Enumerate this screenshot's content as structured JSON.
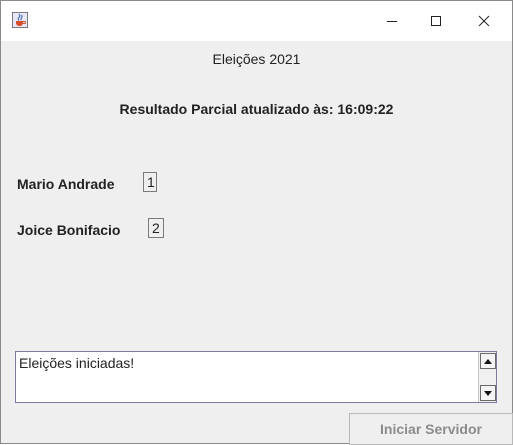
{
  "window": {
    "icon": "java-cup-icon",
    "controls": {
      "minimize": "minimize-icon",
      "maximize": "maximize-icon",
      "close": "close-icon"
    }
  },
  "header": {
    "title": "Eleições 2021",
    "status": "Resultado Parcial atualizado às:  16:09:22"
  },
  "candidates": [
    {
      "name": "Mario Andrade",
      "votes": "1"
    },
    {
      "name": "Joice Bonifacio",
      "votes": "2"
    }
  ],
  "log": {
    "text": "Eleições iniciadas!"
  },
  "footer": {
    "start_button": "Iniciar Servidor"
  }
}
